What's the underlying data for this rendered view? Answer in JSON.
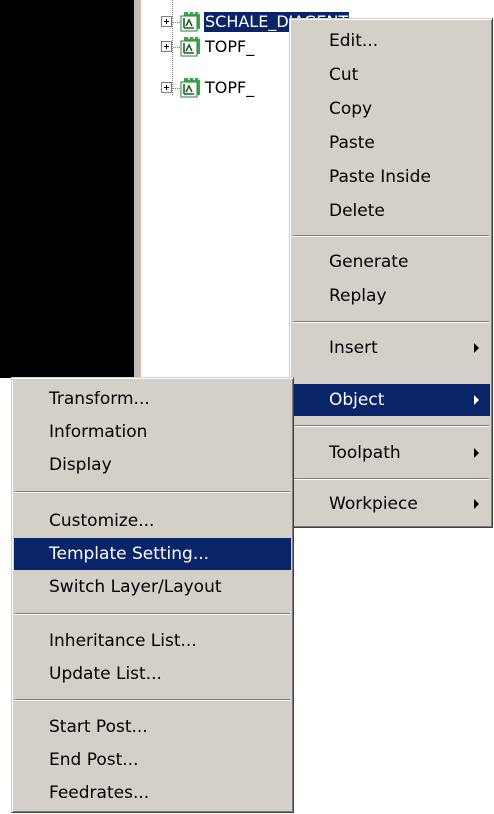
{
  "tree": {
    "items": [
      {
        "label": "SCHALE_DIAGENT",
        "selected": true
      },
      {
        "label": "TOPF_",
        "selected": false
      },
      {
        "label": "TOPF_",
        "selected": false
      }
    ],
    "expand_icon": "plus-box-icon",
    "node_icon": "toolpath-group-icon"
  },
  "context_menu": {
    "items": [
      "Edit...",
      "Cut",
      "Copy",
      "Paste",
      "Paste Inside",
      "Delete",
      "Generate",
      "Replay",
      "Insert",
      "Object",
      "Toolpath",
      "Workpiece"
    ],
    "highlighted": "Object"
  },
  "submenu": {
    "items": [
      "Transform...",
      "Information",
      "Display",
      "Customize...",
      "Template Setting...",
      "Switch Layer/Layout",
      "Inheritance List...",
      "Update List...",
      "Start Post...",
      "End Post...",
      "Feedrates..."
    ],
    "highlighted": "Template Setting..."
  },
  "colors": {
    "menu_bg": "#d4d0c8",
    "highlight": "#0a246a",
    "highlight_text": "#ffffff"
  }
}
